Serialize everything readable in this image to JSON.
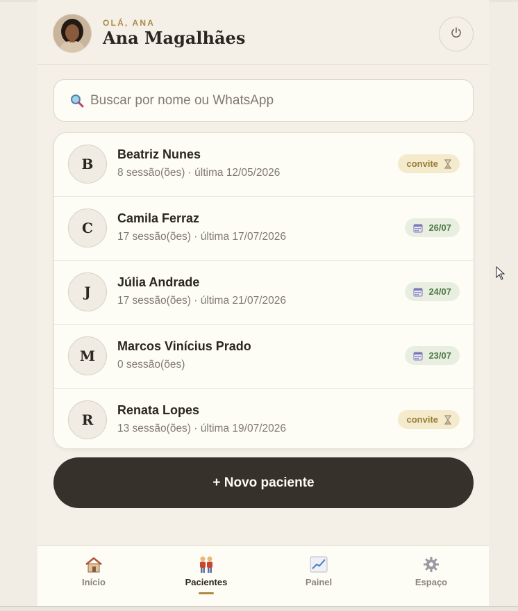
{
  "header": {
    "greeting": "OLÁ, ANA",
    "user_name": "Ana Magalhães"
  },
  "search": {
    "placeholder": "Buscar por nome ou WhatsApp"
  },
  "patients": [
    {
      "initial": "B",
      "name": "Beatriz Nunes",
      "meta": "8 sessão(ões) · última 12/05/2026",
      "badge_type": "invite",
      "badge_text": "convite",
      "badge_icon": "hourglass-icon"
    },
    {
      "initial": "C",
      "name": "Camila Ferraz",
      "meta": "17 sessão(ões) · última 17/07/2026",
      "badge_type": "date",
      "badge_text": "26/07",
      "badge_icon": "calendar-icon"
    },
    {
      "initial": "J",
      "name": "Júlia Andrade",
      "meta": "17 sessão(ões) · última 21/07/2026",
      "badge_type": "date",
      "badge_text": "24/07",
      "badge_icon": "calendar-icon"
    },
    {
      "initial": "M",
      "name": "Marcos Vinícius Prado",
      "meta": "0 sessão(ões)",
      "badge_type": "date",
      "badge_text": "23/07",
      "badge_icon": "calendar-icon"
    },
    {
      "initial": "R",
      "name": "Renata Lopes",
      "meta": "13 sessão(ões) · última 19/07/2026",
      "badge_type": "invite",
      "badge_text": "convite",
      "badge_icon": "hourglass-icon"
    }
  ],
  "actions": {
    "new_patient": "+ Novo paciente"
  },
  "nav": {
    "items": [
      {
        "label": "Início",
        "icon": "house-icon",
        "active": false
      },
      {
        "label": "Pacientes",
        "icon": "people-icon",
        "active": true
      },
      {
        "label": "Painel",
        "icon": "chart-icon",
        "active": false
      },
      {
        "label": "Espaço",
        "icon": "gear-icon",
        "active": false
      }
    ]
  },
  "colors": {
    "accent": "#b08a45",
    "dark_button": "#37312b",
    "invite_badge_bg": "#f4ebcd",
    "date_badge_bg": "#e9efe0",
    "background": "#f4f0e8"
  }
}
